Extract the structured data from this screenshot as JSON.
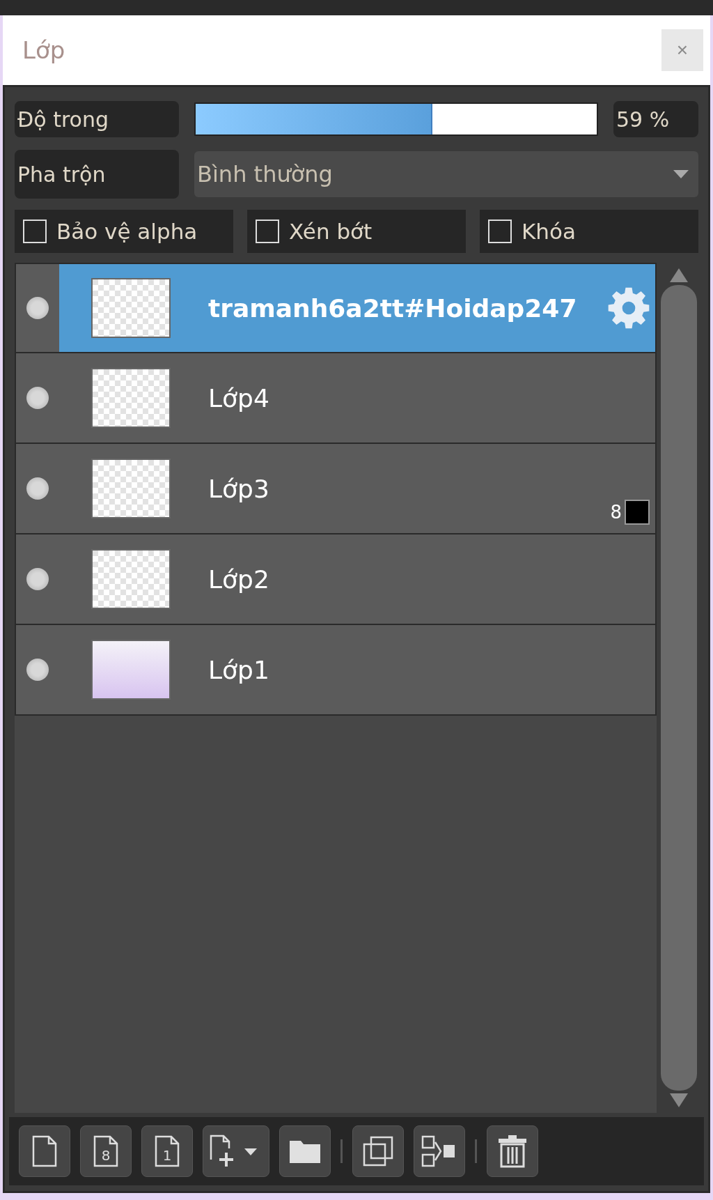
{
  "panel": {
    "title": "Lớp",
    "close": "×"
  },
  "opacity": {
    "label": "Độ trong",
    "level": 0.59,
    "reading": "59 %"
  },
  "blend": {
    "label": "Pha trộn",
    "value": "Bình thường"
  },
  "options": [
    {
      "label": "Bảo vệ alpha",
      "checked": false
    },
    {
      "label": "Xén bớt",
      "checked": false
    },
    {
      "label": "Khóa",
      "checked": false
    }
  ],
  "layers": [
    {
      "name": "tramanh6a2tt#Hoidap247",
      "selected": true,
      "thumbnail": {
        "kind": "checker"
      },
      "settings": true
    },
    {
      "name": "Lớp4",
      "selected": false,
      "thumbnail": {
        "kind": "checker"
      }
    },
    {
      "name": "Lớp3",
      "selected": false,
      "thumbnail": {
        "kind": "checker"
      },
      "badge": "8",
      "color": "#000000"
    },
    {
      "name": "Lớp2",
      "selected": false,
      "thumbnail": {
        "kind": "checker"
      }
    },
    {
      "name": "Lớp1",
      "selected": false,
      "thumbnail": {
        "kind": "gradient"
      }
    }
  ],
  "toolbar": [
    {
      "kind": "page"
    },
    {
      "kind": "page",
      "glyph": "8"
    },
    {
      "kind": "page",
      "glyph": "1"
    },
    {
      "kind": "add"
    },
    {
      "kind": "folder"
    },
    {
      "kind": "separator"
    },
    {
      "kind": "duplicate"
    },
    {
      "kind": "merge"
    },
    {
      "kind": "separator"
    },
    {
      "kind": "trash"
    }
  ]
}
